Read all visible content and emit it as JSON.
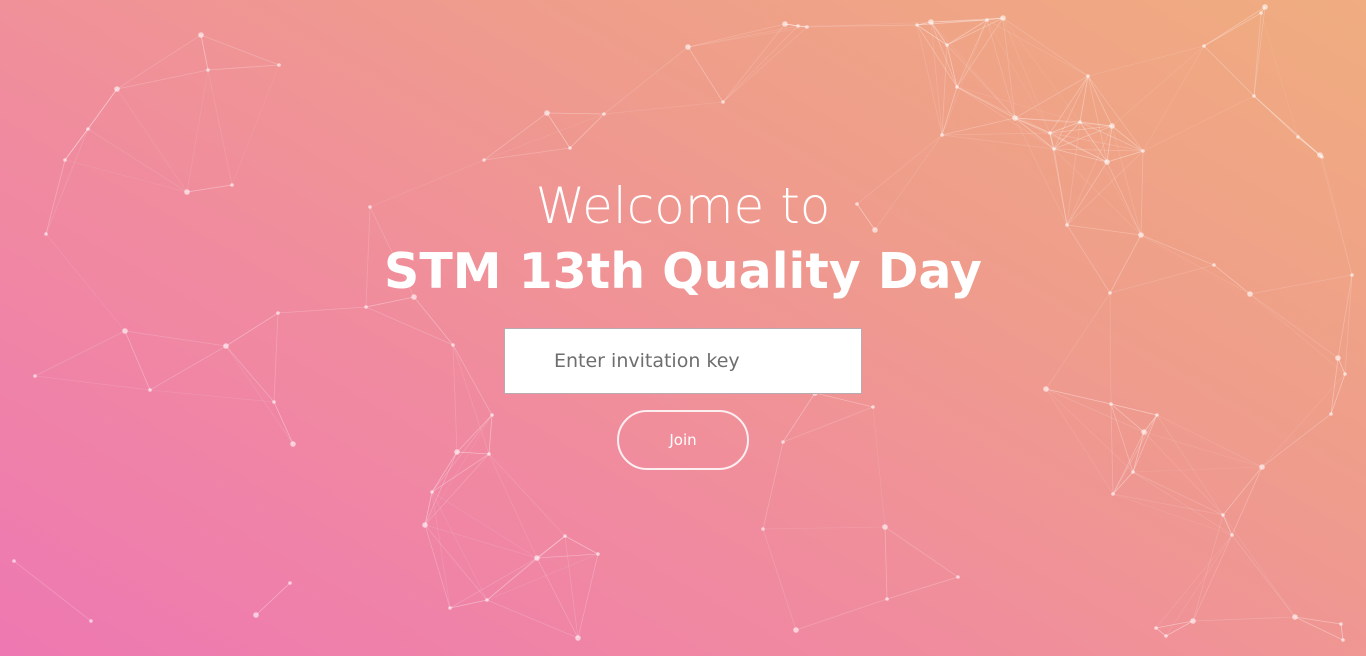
{
  "hero": {
    "welcome": "Welcome to",
    "title": "STM 13th Quality Day"
  },
  "invitation": {
    "placeholder": "Enter invitation key",
    "value": ""
  },
  "join_button": {
    "label": "Join"
  },
  "colors": {
    "gradient_start": "#ee78b2",
    "gradient_end": "#f0ad80",
    "text": "#ffffff"
  }
}
